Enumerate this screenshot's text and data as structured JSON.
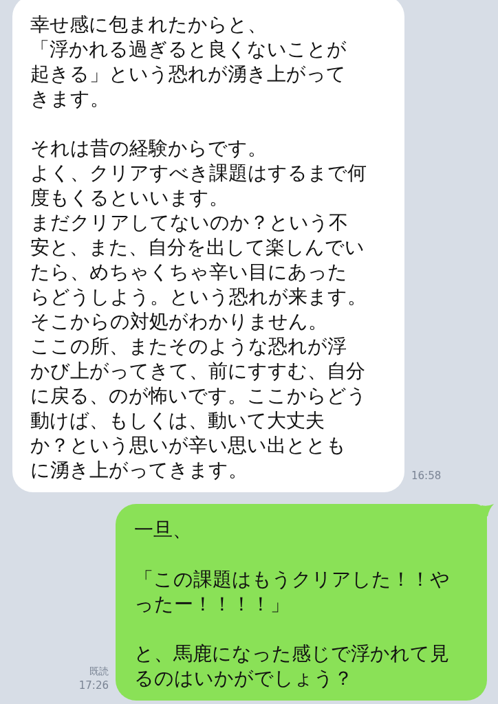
{
  "messages": [
    {
      "kind": "received",
      "paragraphs": [
        [
          "幸せ感に包まれたからと、",
          "「浮かれる過ぎると良くないことが",
          "起きる」という恐れが湧き上がって",
          "きます。"
        ],
        [
          "それは昔の経験からです。",
          "よく、クリアすべき課題はするまで何",
          "度もくるといいます。",
          "まだクリアしてないのか？という不",
          "安と、また、自分を出して楽しんでい",
          "たら、めちゃくちゃ辛い目にあった",
          "らどうしよう。という恐れが来ます。",
          "そこからの対処がわかりません。",
          "ここの所、またそのような恐れが浮",
          "かび上がってきて、前にすすむ、自分",
          "に戻る、のが怖いです。ここからどう",
          "動けば、もしくは、動いて大丈夫",
          "か？という思いが辛い思い出ととも",
          "に湧き上がってきます。"
        ]
      ],
      "time": "16:58"
    },
    {
      "kind": "sent",
      "paragraphs": [
        [
          "一旦、"
        ],
        [
          "「この課題はもうクリアした！！や",
          "ったー！！！！」"
        ],
        [
          "と、馬鹿になった感じで浮かれて見",
          "るのはいかがでしょう？"
        ]
      ],
      "read": "既読",
      "time": "17:26"
    }
  ]
}
